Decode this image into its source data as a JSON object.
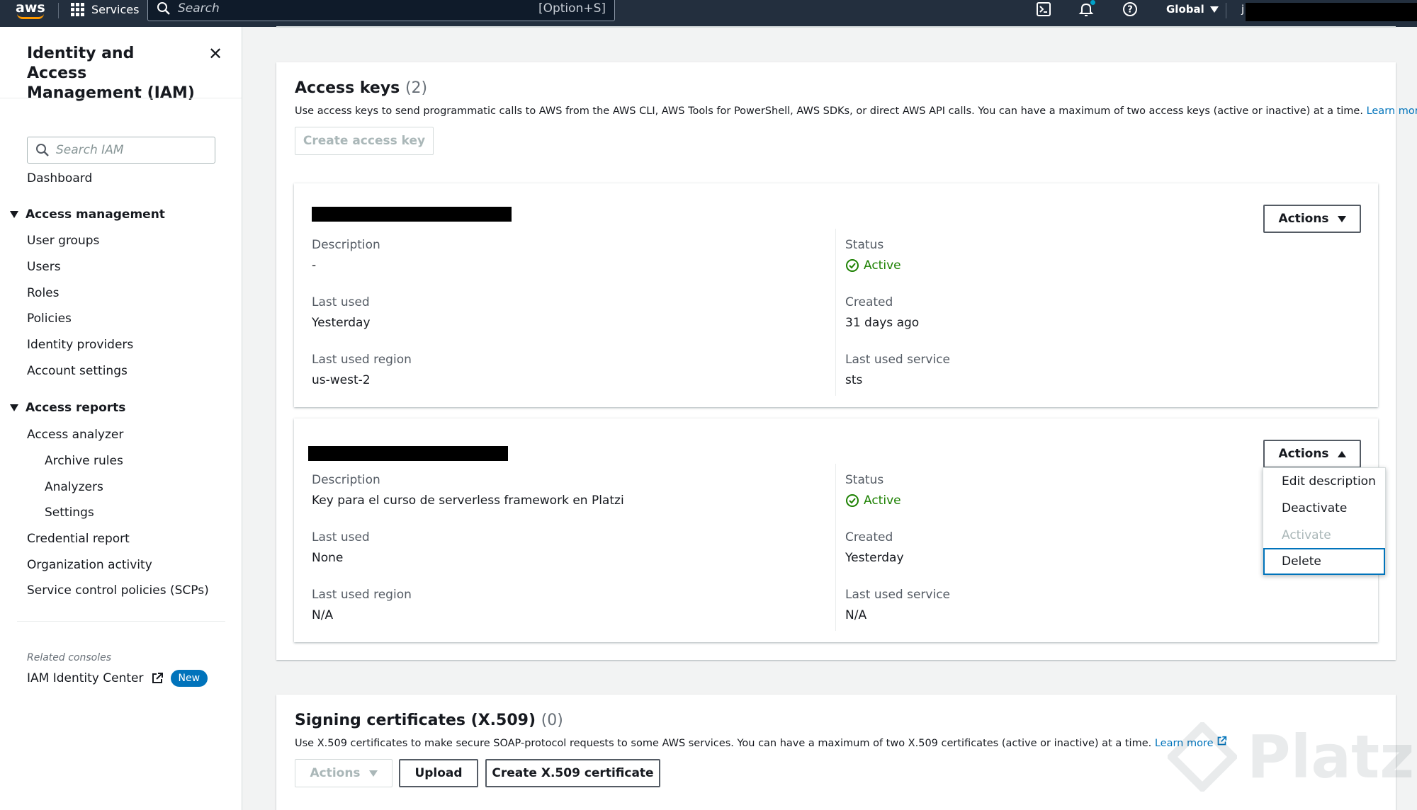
{
  "topnav": {
    "logo": "aws",
    "services": "Services",
    "search_placeholder": "Search",
    "search_shortcut": "[Option+S]",
    "region": "Global",
    "account_initial": "j"
  },
  "sidebar": {
    "title": "Identity and Access Management (IAM)",
    "search_placeholder": "Search IAM",
    "dashboard": "Dashboard",
    "access_management": {
      "label": "Access management",
      "items": [
        "User groups",
        "Users",
        "Roles",
        "Policies",
        "Identity providers",
        "Account settings"
      ]
    },
    "access_reports": {
      "label": "Access reports",
      "items": [
        "Access analyzer",
        "Archive rules",
        "Analyzers",
        "Settings",
        "Credential report",
        "Organization activity",
        "Service control policies (SCPs)"
      ]
    },
    "related_consoles": "Related consoles",
    "identity_center": "IAM Identity Center",
    "badge_new": "New"
  },
  "access_keys": {
    "title": "Access keys",
    "count": "(2)",
    "description": "Use access keys to send programmatic calls to AWS from the AWS CLI, AWS Tools for PowerShell, AWS SDKs, or direct AWS API calls. You can have a maximum of two access keys (active or inactive) at a time.",
    "learn_more": "Learn more",
    "create_button": "Create access key",
    "labels": {
      "description": "Description",
      "status": "Status",
      "last_used": "Last used",
      "created": "Created",
      "last_used_region": "Last used region",
      "last_used_service": "Last used service"
    },
    "keys": [
      {
        "actions": "Actions",
        "description": "-",
        "status": "Active",
        "last_used": "Yesterday",
        "created": "31 days ago",
        "last_used_region": "us-west-2",
        "last_used_service": "sts"
      },
      {
        "actions": "Actions",
        "description": "Key para el curso de serverless framework en Platzi",
        "status": "Active",
        "last_used": "None",
        "created": "Yesterday",
        "last_used_region": "N/A",
        "last_used_service": "N/A"
      }
    ],
    "menu": [
      "Edit description",
      "Deactivate",
      "Activate",
      "Delete"
    ]
  },
  "signing_certificates": {
    "title": "Signing certificates (X.509)",
    "count": "(0)",
    "description": "Use X.509 certificates to make secure SOAP-protocol requests to some AWS services. You can have a maximum of two X.509 certificates (active or inactive) at a time.",
    "learn_more": "Learn more",
    "actions_button": "Actions",
    "upload_button": "Upload",
    "create_button": "Create X.509 certificate"
  },
  "watermark": "Platzi",
  "colors": {
    "nav_bg": "#232f3e",
    "accent": "#ff9900",
    "link": "#0073bb",
    "active_green": "#1d8102"
  }
}
